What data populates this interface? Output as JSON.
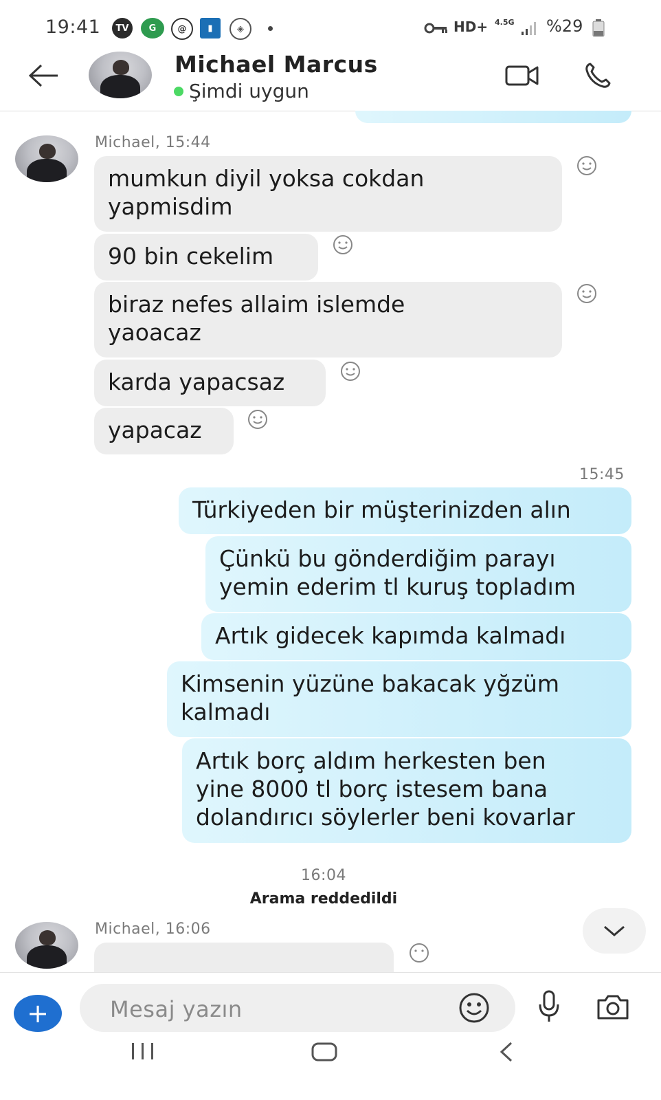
{
  "status_bar": {
    "time": "19:41",
    "network": "HD+",
    "signal_label": "4.5G",
    "battery": "%29",
    "icons": [
      "tv-icon",
      "globe-app-icon",
      "sync-app-icon",
      "bank-app-icon",
      "shield-app-icon",
      "notification-dot-icon",
      "vpn-key-icon",
      "signal-icon",
      "battery-icon"
    ]
  },
  "header": {
    "contact_name": "Michael Marcus",
    "status": "Şimdi uygun",
    "icons": [
      "back-arrow-icon",
      "video-call-icon",
      "phone-call-icon"
    ]
  },
  "chat": {
    "incoming_group_1": {
      "sender_time": "Michael, 15:44",
      "messages": [
        {
          "text_line1": "mumkun diyil yoksa cokdan",
          "text_line2": "yapmisdim"
        },
        {
          "text_line1": "90 bin cekelim"
        },
        {
          "text_line1": "biraz nefes allaim islemde",
          "text_line2": "yaoacaz"
        },
        {
          "text_line1": "karda yapacsaz"
        },
        {
          "text_line1": "yapacaz"
        }
      ]
    },
    "outgoing_group": {
      "time": "15:45",
      "messages": [
        {
          "text_line1": "Türkiyeden bir müşterinizden alın"
        },
        {
          "text_line1": "Çünkü bu gönderdiğim parayı",
          "text_line2": "yemin ederim tl kuruş topladım"
        },
        {
          "text_line1": "Artık gidecek kapımda kalmadı"
        },
        {
          "text_line1": "Kimsenin yüzüne bakacak yğzüm",
          "text_line2": "kalmadı"
        },
        {
          "text_line1": "Artık borç aldım herkesten ben",
          "text_line2": "yine 8000 tl borç istesem bana",
          "text_line3": "dolandırıcı söylerler beni kovarlar"
        }
      ]
    },
    "call_event": {
      "time": "16:04",
      "text": "Arama reddedildi"
    },
    "incoming_group_2": {
      "sender_time": "Michael, 16:06"
    }
  },
  "composer": {
    "placeholder": "Mesaj yazın",
    "icons": [
      "plus-icon",
      "emoji-icon",
      "microphone-icon",
      "camera-icon"
    ]
  },
  "colors": {
    "incoming_bubble": "#ededed",
    "outgoing_bubble": "#c9eefb",
    "online_dot": "#4cd964",
    "plus_button": "#1f6fd0"
  }
}
